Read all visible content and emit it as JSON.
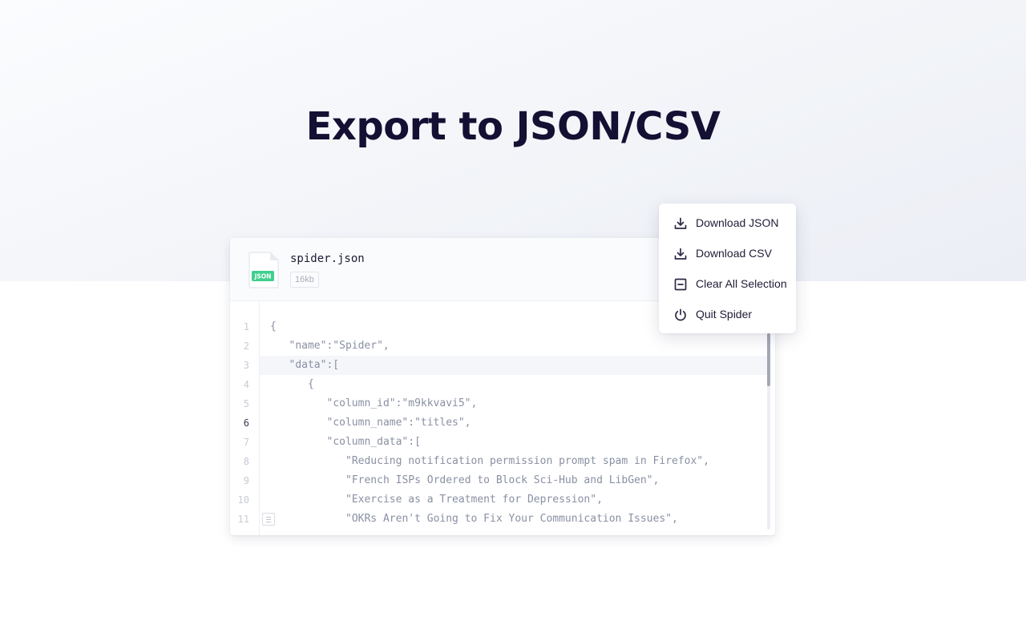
{
  "page": {
    "title": "Export to JSON/CSV"
  },
  "file": {
    "name": "spider.json",
    "size": "16kb",
    "icon_badge": "JSON"
  },
  "editor": {
    "lines": [
      {
        "num": "1",
        "indent": 0,
        "text": "{"
      },
      {
        "num": "2",
        "indent": 1,
        "text": "\"name\":\"Spider\","
      },
      {
        "num": "3",
        "indent": 1,
        "text": "\"data\":["
      },
      {
        "num": "4",
        "indent": 2,
        "text": "{"
      },
      {
        "num": "5",
        "indent": 3,
        "text": "\"column_id\":\"m9kkvavi5\","
      },
      {
        "num": "6",
        "indent": 3,
        "text": "\"column_name\":\"titles\","
      },
      {
        "num": "7",
        "indent": 3,
        "text": "\"column_data\":["
      },
      {
        "num": "8",
        "indent": 4,
        "text": "\"Reducing notification permission prompt spam in Firefox\","
      },
      {
        "num": "9",
        "indent": 4,
        "text": "\"French ISPs Ordered to Block Sci-Hub and LibGen\","
      },
      {
        "num": "10",
        "indent": 4,
        "text": "\"Exercise as a Treatment for Depression\","
      },
      {
        "num": "11",
        "indent": 4,
        "text": "\"OKRs Aren't Going to Fix Your Communication Issues\","
      }
    ],
    "active_line": "3",
    "marked_line": "6"
  },
  "menu": {
    "items": [
      {
        "label": "Download JSON",
        "icon": "download-icon"
      },
      {
        "label": "Download CSV",
        "icon": "download-icon"
      },
      {
        "label": "Clear All Selection",
        "icon": "minus-square-icon"
      },
      {
        "label": "Quit Spider",
        "icon": "power-icon"
      }
    ]
  },
  "colors": {
    "title": "#140f33",
    "json_badge": "#3fcf8e",
    "code_text": "#8a90a3",
    "active_line_bg": "#f5f6fa"
  }
}
